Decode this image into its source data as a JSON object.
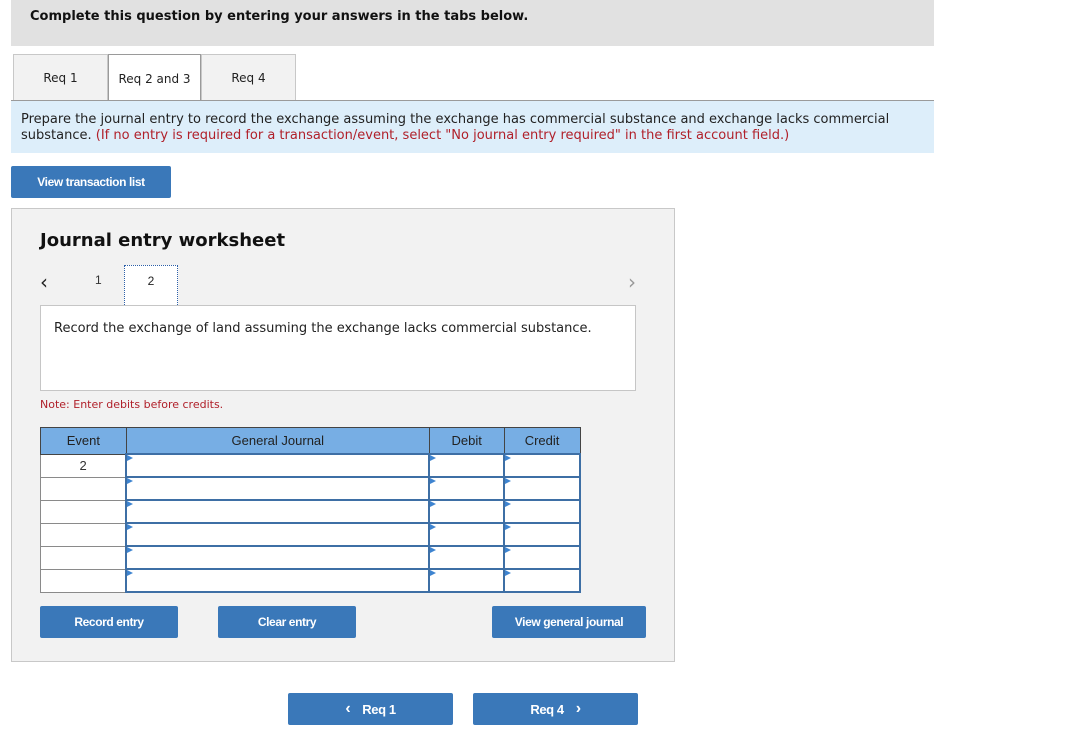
{
  "header": {
    "instruction": "Complete this question by entering your answers in the tabs below."
  },
  "tabs": [
    {
      "label": "Req 1",
      "active": false
    },
    {
      "label": "Req 2 and 3",
      "active": true
    },
    {
      "label": "Req 4",
      "active": false
    }
  ],
  "instructions": {
    "main": "Prepare the journal entry to record the exchange assuming the exchange has commercial substance and exchange lacks commercial substance.",
    "note": "(If no entry is required for a transaction/event, select \"No journal entry required\" in the first account field.)"
  },
  "view_transaction_list_label": "View transaction list",
  "worksheet": {
    "title": "Journal entry worksheet",
    "prev_icon": "‹",
    "next_icon": "›",
    "pages": [
      "1",
      "2"
    ],
    "current_page": "2",
    "description": "Record the exchange of land assuming the exchange lacks commercial substance.",
    "note": "Note: Enter debits before credits.",
    "columns": [
      "Event",
      "General Journal",
      "Debit",
      "Credit"
    ],
    "rows": [
      {
        "event": "2",
        "account": "",
        "debit": "",
        "credit": ""
      },
      {
        "event": "",
        "account": "",
        "debit": "",
        "credit": ""
      },
      {
        "event": "",
        "account": "",
        "debit": "",
        "credit": ""
      },
      {
        "event": "",
        "account": "",
        "debit": "",
        "credit": ""
      },
      {
        "event": "",
        "account": "",
        "debit": "",
        "credit": ""
      },
      {
        "event": "",
        "account": "",
        "debit": "",
        "credit": ""
      }
    ],
    "buttons": {
      "record": "Record entry",
      "clear": "Clear entry",
      "view_journal": "View general journal"
    }
  },
  "bottom_nav": {
    "prev_label": "Req 1",
    "prev_icon": "‹",
    "next_label": "Req 4",
    "next_icon": "›"
  },
  "colors": {
    "button_blue": "#3a78b9",
    "table_header": "#77aee4",
    "instruction_bg": "#ddeefa",
    "warning_red": "#b0202a"
  }
}
